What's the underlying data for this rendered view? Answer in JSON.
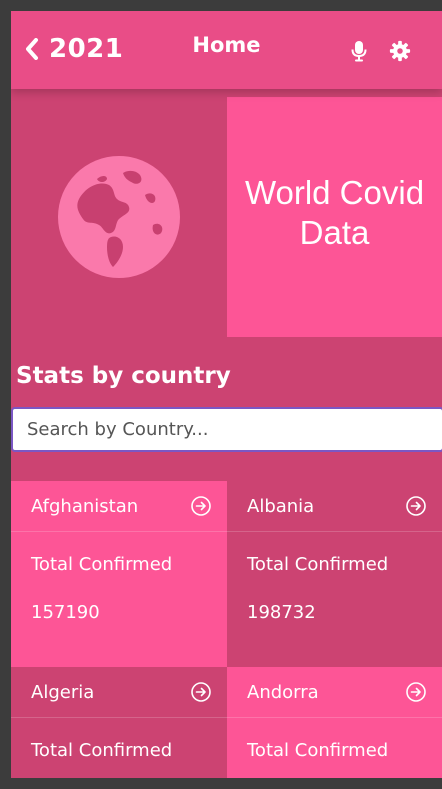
{
  "header": {
    "back_icon": "chevron-left-icon",
    "year": "2021",
    "title": "Home",
    "mic_icon": "microphone-icon",
    "settings_icon": "gear-icon"
  },
  "hero": {
    "globe_icon": "globe-icon",
    "title": "World Covid\nData"
  },
  "stats": {
    "heading": "Stats by country",
    "search_placeholder": "Search by Country..."
  },
  "countries": [
    {
      "name": "Afghanistan",
      "label": "Total Confirmed",
      "value": "157190"
    },
    {
      "name": "Albania",
      "label": "Total Confirmed",
      "value": "198732"
    },
    {
      "name": "Algeria",
      "label": "Total Confirmed",
      "value": ""
    },
    {
      "name": "Andorra",
      "label": "Total Confirmed",
      "value": ""
    }
  ],
  "colors": {
    "header_bg": "#e94d87",
    "pink": "#fd5596",
    "rose": "#cc4372",
    "search_border": "#7b57c4"
  }
}
